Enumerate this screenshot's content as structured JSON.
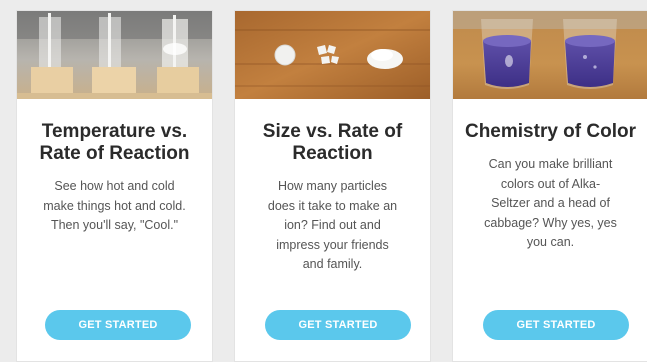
{
  "colors": {
    "background": "#ececec",
    "card": "#ffffff",
    "title": "#2b2b2b",
    "text": "#555555",
    "button": "#5bc8ec",
    "button_text": "#ffffff"
  },
  "cards": [
    {
      "image": "temperature-reaction-photo",
      "title": "Temperature vs. Rate of Reaction",
      "description": "See how hot and cold make things hot and cold. Then you'll say, \"Cool.\"",
      "button_label": "GET STARTED"
    },
    {
      "image": "particle-size-photo",
      "title": "Size vs. Rate of Reaction",
      "description": "How many particles does it take to make an ion? Find out and impress your friends and family.",
      "button_label": "GET STARTED"
    },
    {
      "image": "color-chemistry-photo",
      "title": "Chemistry of Color",
      "description": "Can you make brilliant colors out of Alka-Seltzer and a head of cabbage? Why yes, yes you can.",
      "button_label": "GET STARTED"
    }
  ]
}
